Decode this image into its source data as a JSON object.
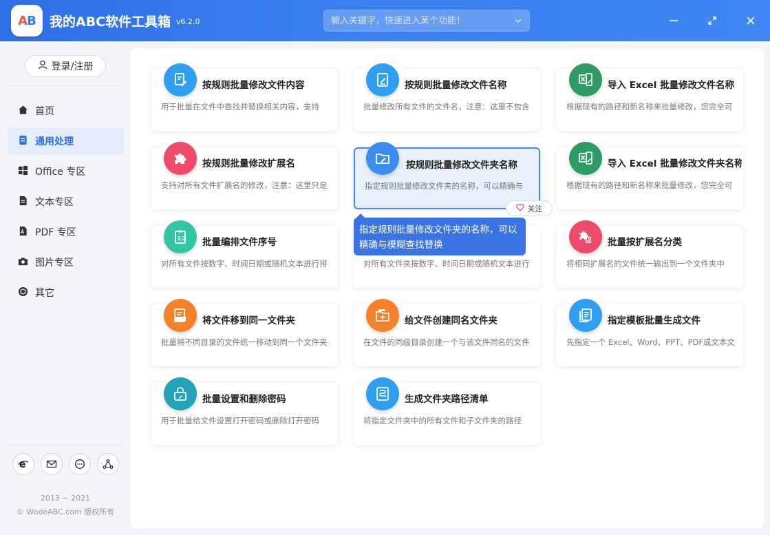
{
  "app": {
    "title": "我的ABC软件工具箱",
    "version": "v6.2.0",
    "logo_text_a": "A",
    "logo_text_b": "B"
  },
  "search": {
    "placeholder": "输入关键字，快速进入某个功能！"
  },
  "sidebar": {
    "login_label": "登录/注册",
    "items": [
      {
        "label": "首页",
        "icon": "home-icon"
      },
      {
        "label": "通用处理",
        "icon": "document-icon",
        "active": true
      },
      {
        "label": "Office 专区",
        "icon": "windows-icon"
      },
      {
        "label": "文本专区",
        "icon": "file-text-icon"
      },
      {
        "label": "PDF 专区",
        "icon": "pdf-icon"
      },
      {
        "label": "图片专区",
        "icon": "camera-icon"
      },
      {
        "label": "其它",
        "icon": "cube-icon"
      }
    ],
    "bottom_icons": [
      "ie-icon",
      "mail-icon",
      "chat-icon",
      "share-icon"
    ],
    "copyright_years": "2013 ~ 2021",
    "copyright_text": "© WodeABC.com 版权所有"
  },
  "cards": [
    {
      "title": "按规则批量修改文件内容",
      "desc": "用于批量在文件中查找并替换相关内容，支持",
      "icon": "edit-document-icon",
      "color": "#2f9ff2"
    },
    {
      "title": "按规则批量修改文件名称",
      "desc": "批量修改所有文件的文件名，注意：这里不包含",
      "icon": "rename-file-icon",
      "color": "#2f9ff2"
    },
    {
      "title": "导入 Excel 批量修改文件名称",
      "desc": "根据现有的路径和新名称来批量修改，您完全可",
      "icon": "excel-icon",
      "color": "#2e9a64"
    },
    {
      "title": "按规则批量修改扩展名",
      "desc": "支持对所有文件扩展名的修改，注意：这里只是",
      "icon": "puzzle-icon",
      "color": "#f04a6a"
    },
    {
      "title": "按规则批量修改文件夹名称",
      "desc": "指定规则批量修改文件夹的名称，可以精确与",
      "icon": "folder-edit-icon",
      "color": "#3b8ef0"
    },
    {
      "title": "导入 Excel 批量修改文件夹名称",
      "desc": "根据现有的路径和新名称来批量修改，您完全可",
      "icon": "excel-icon",
      "color": "#2e9a64"
    },
    {
      "title": "批量编排文件序号",
      "desc": "对所有文件按数字、时间日期或随机文本进行排",
      "icon": "numbering-icon",
      "color": "#33c6a4"
    },
    {
      "title": "",
      "desc": "对所有文件夹按数字、时间日期或随机文本进行",
      "icon": "",
      "color": ""
    },
    {
      "title": "批量按扩展名分类",
      "desc": "将相同扩展名的文件统一输出到一个文件夹中",
      "icon": "puzzle-category-icon",
      "color": "#f04a6a"
    },
    {
      "title": "将文件移到同一文件夹",
      "desc": "批量将不同目录的文件统一移动到同一个文件夹",
      "icon": "move-file-icon",
      "color": "#f5812a"
    },
    {
      "title": "给文件创建同名文件夹",
      "desc": "在文件的同级目录创建一个与该文件同名的文件",
      "icon": "create-folder-icon",
      "color": "#f5812a"
    },
    {
      "title": "指定模板批量生成文件",
      "desc": "先指定一个 Excel、Word、PPT、PDF或文本文",
      "icon": "template-icon",
      "color": "#2f9ff2"
    },
    {
      "title": "批量设置和删除密码",
      "desc": "用于批量给文件设置打开密码或删除打开密码",
      "icon": "lock-icon",
      "color": "#22a3b8"
    },
    {
      "title": "生成文件夹路径清单",
      "desc": "将指定文件夹中的所有文件和子文件夹的路径",
      "icon": "path-list-icon",
      "color": "#2f9ff2"
    }
  ],
  "follow": {
    "label": "关注"
  },
  "tooltip": {
    "text": "指定规则批量修改文件夹的名称，可以精确与模糊查找替换"
  },
  "colors": {
    "titlebar": "#2f6fe8",
    "accent": "#2f6fe8",
    "tooltip": "#3a73e3"
  }
}
